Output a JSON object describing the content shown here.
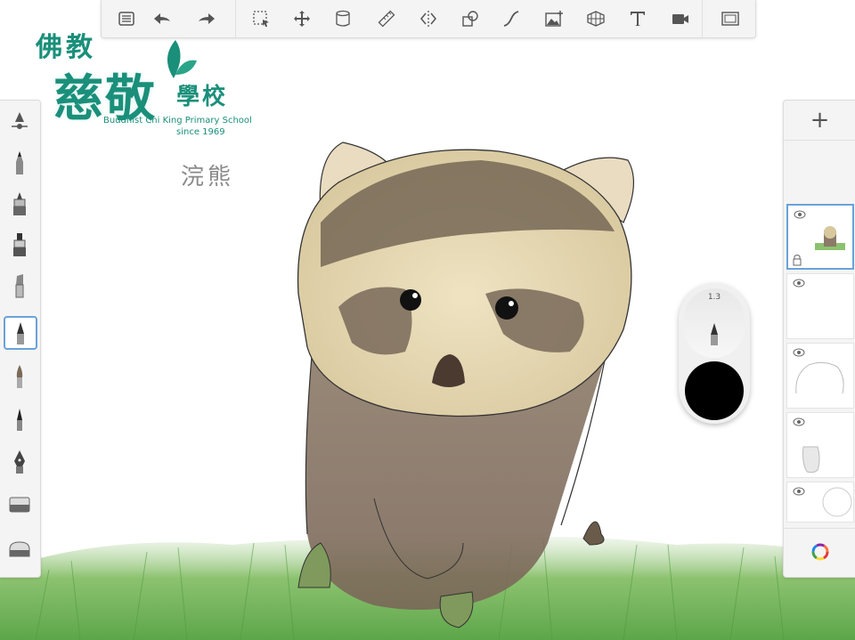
{
  "logo": {
    "line1": "佛教",
    "line2": "慈敬",
    "line3": "學校",
    "english": "Buddhist Chi King Primary School",
    "since": "since 1969"
  },
  "handwritten_label": "浣熊",
  "toolbar": {
    "tools": [
      "list-icon",
      "undo-icon",
      "redo-icon",
      "selection-icon",
      "transform-icon",
      "canvas-icon",
      "ruler-icon",
      "symmetry-icon",
      "shapes-icon",
      "curve-icon",
      "image-icon",
      "perspective-icon",
      "text-icon",
      "record-icon",
      "fullscreen-icon"
    ]
  },
  "brush_puck": {
    "size_value": "1.3",
    "color": "#000000"
  },
  "layers": {
    "add_label": "+"
  },
  "colors": {
    "accent": "#6aa2d8",
    "logo": "#1a8f7a",
    "panel": "#f4f4f4"
  }
}
